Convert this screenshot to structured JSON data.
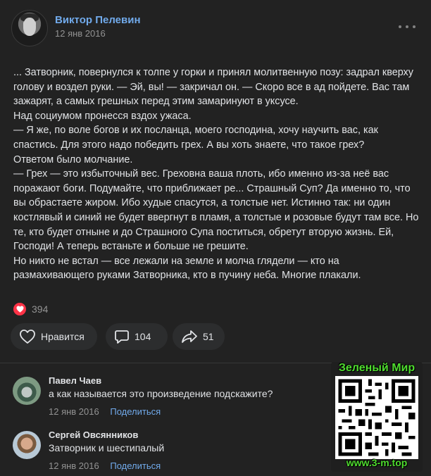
{
  "post": {
    "author": "Виктор Пелевин",
    "date": "12 янв 2016",
    "paragraphs": [
      "... Затворник, повернулся к толпе у горки и принял молитвенную позу: задрал кверху голову и воздел руки. — Эй, вы! — закричал он. — Скоро все в ад пойдете. Вас там зажарят, а самых грешных перед этим замаринуют в уксусе.",
      "Над социумом пронесся вздох ужаса.",
      "— Я же, по воле богов и их посланца, моего господина, хочу научить вас, как спастись. Для этого надо победить грех. А вы хоть знаете, что такое грех?",
      "Ответом было молчание.",
      "— Грех — это избыточный вес. Греховна ваша плоть, ибо именно из-за неё вас поражают боги. Подумайте, что приближает ре... Страшный Суп? Да именно то, что вы обрастаете жиром. Ибо худые спасутся, а толстые нет. Истинно так: ни один костлявый и синий не будет ввергнут в пламя, а толстые и розовые будут там все. Но те, кто будет отныне и до Страшного Супа поститься, обретут вторую жизнь. Ей, Господи! А теперь встаньте и больше не грешите.",
      "Но никто не встал — все лежали на земле и молча глядели — кто на размахивающего руками Затворника, кто в пучину неба. Многие плакали."
    ],
    "reactions_count": "394",
    "like_label": "Нравится",
    "comments_count": "104",
    "shares_count": "51"
  },
  "comments": [
    {
      "author": "Павел Чаев",
      "text": "а как называется это произведение подскажите?",
      "date": "12 янв 2016",
      "share_label": "Поделиться"
    },
    {
      "author": "Сергей Овсянников",
      "text": "Затворник и шестипалый",
      "date": "12 янв 2016",
      "share_label": "Поделиться"
    }
  ],
  "watermark": {
    "title": "Зеленый Мир",
    "url": "www.3-m.top"
  },
  "colors": {
    "background": "#222222",
    "link": "#71aaeb",
    "heart": "#ff3347",
    "watermark_green": "#4fdc2f"
  },
  "icons": [
    "more-horizontal-icon",
    "heart-icon",
    "comment-icon",
    "share-icon"
  ]
}
